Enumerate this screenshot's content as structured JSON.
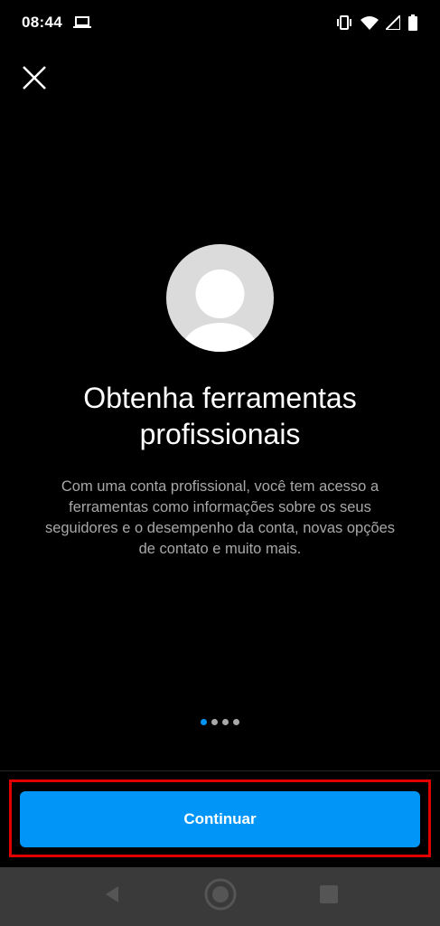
{
  "status_bar": {
    "time": "08:44",
    "icons": [
      "laptop-icon",
      "vibrate-icon",
      "wifi-icon",
      "signal-icon",
      "battery-icon"
    ]
  },
  "header": {
    "close_icon": "close-icon"
  },
  "content": {
    "title_line1": "Obtenha ferramentas",
    "title_line2": "profissionais",
    "description": "Com uma conta profissional, você tem acesso a ferramentas como informações sobre os seus seguidores e o desempenho da conta, novas opções de contato e muito mais."
  },
  "pager": {
    "total": 4,
    "current": 1
  },
  "footer": {
    "continue_label": "Continuar"
  },
  "nav_bar": {
    "icons": [
      "back-icon",
      "home-icon",
      "recents-icon"
    ]
  },
  "colors": {
    "accent": "#0095f6",
    "background": "#000000",
    "highlight": "#e00000",
    "nav_bar": "#3a3a3a"
  }
}
